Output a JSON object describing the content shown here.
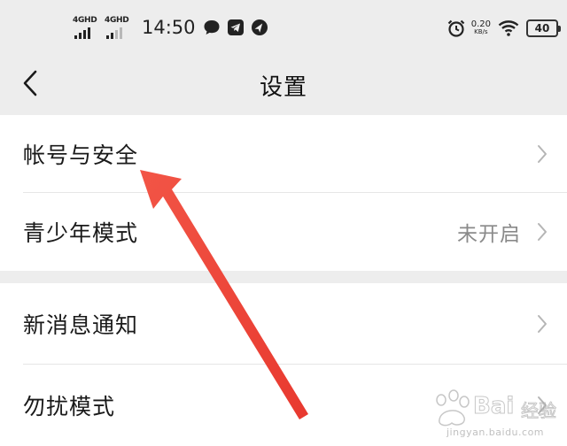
{
  "status_bar": {
    "signal_1": "4GHD",
    "signal_2": "4GHD",
    "time": "14:50",
    "icons": [
      "chat-bubble-icon",
      "telegram-icon",
      "navigation-icon",
      "alarm-icon",
      "wifi-icon"
    ],
    "net_speed_value": "0.20",
    "net_speed_unit": "KB/s",
    "battery_level": "40"
  },
  "header": {
    "title": "设置",
    "back_icon": "chevron-left-icon"
  },
  "settings": {
    "group_1": [
      {
        "label": "帐号与安全",
        "value": ""
      },
      {
        "label": "青少年模式",
        "value": "未开启"
      }
    ],
    "group_2": [
      {
        "label": "新消息通知",
        "value": ""
      },
      {
        "label": "勿扰模式",
        "value": ""
      }
    ]
  },
  "watermark": {
    "brand_latin": "Bai",
    "brand_cn": "经验",
    "url": "jingyan.baidu.com"
  },
  "colors": {
    "background": "#ededed",
    "row_background": "#ffffff",
    "arrow": "#f0453a",
    "value_text": "#8a8a8a"
  }
}
